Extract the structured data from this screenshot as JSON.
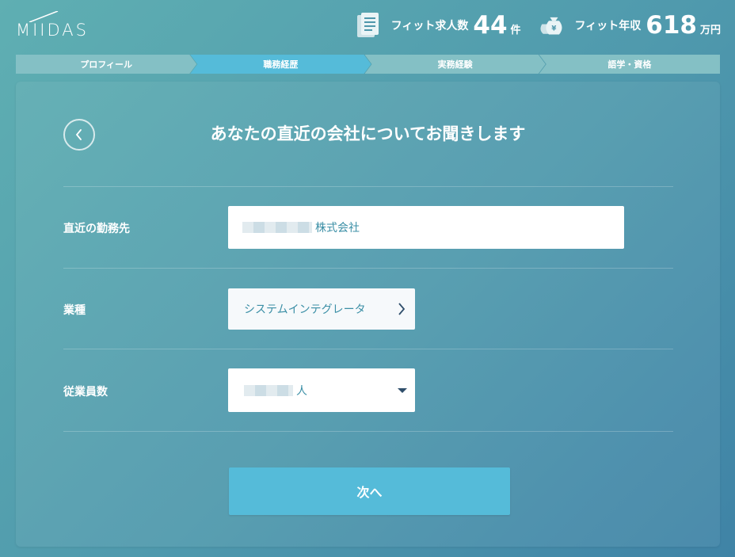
{
  "header": {
    "logo_text": "MIIDAS",
    "job_stat": {
      "label": "フィット求人数",
      "value": "44",
      "unit": "件",
      "icon": "document-icon"
    },
    "salary_stat": {
      "label": "フィット年収",
      "value": "618",
      "unit": "万円",
      "icon": "money-bag-icon"
    }
  },
  "steps": [
    {
      "label": "プロフィール",
      "active": false
    },
    {
      "label": "職務経歴",
      "active": true
    },
    {
      "label": "実務経験",
      "active": false
    },
    {
      "label": "語学・資格",
      "active": false
    }
  ],
  "form": {
    "title": "あなたの直近の会社についてお聞きします",
    "company": {
      "label": "直近の勤務先",
      "value": "株式会社"
    },
    "industry": {
      "label": "業種",
      "value": "システムインテグレータ"
    },
    "employees": {
      "label": "従業員数",
      "value": "人"
    },
    "next_label": "次へ"
  },
  "colors": {
    "accent": "#55bbd9",
    "step_inactive": "#84c0c5",
    "field_text": "#3b8fa6"
  }
}
